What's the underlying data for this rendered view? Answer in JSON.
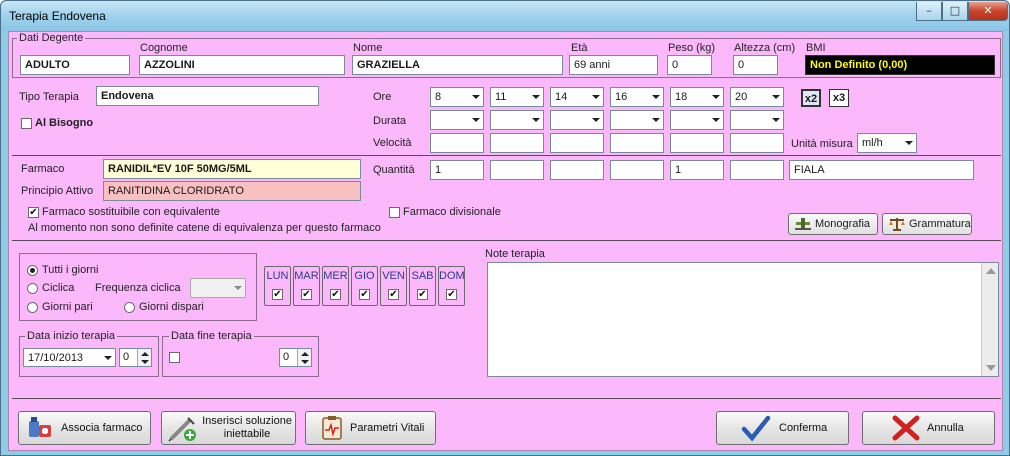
{
  "window": {
    "title": "Terapia Endovena",
    "min_glyph": "–",
    "max_glyph": "□",
    "close_glyph": "✕"
  },
  "patient": {
    "group_label": "Dati Degente",
    "first_label": "ADULTO",
    "surname_label": "Cognome",
    "surname": "AZZOLINI",
    "name_label": "Nome",
    "name": "GRAZIELLA",
    "age_label": "Età",
    "age": "69 anni",
    "weight_label": "Peso (kg)",
    "weight": "0",
    "height_label": "Altezza (cm)",
    "height": "0",
    "bmi_label": "BMI",
    "bmi": "Non Definito (0,00)"
  },
  "therapy": {
    "type_label": "Tipo Terapia",
    "type": "Endovena",
    "as_needed_label": "Al Bisogno",
    "ore_label": "Ore",
    "durata_label": "Durata",
    "velocita_label": "Velocità",
    "hours": [
      "8",
      "11",
      "14",
      "16",
      "18",
      "20"
    ],
    "x2": "x2",
    "x3": "x3",
    "unit_label": "Unità misura",
    "unit": "ml/h"
  },
  "drug": {
    "farmaco_label": "Farmaco",
    "farmaco": "RANIDIL*EV 10F 50MG/5ML",
    "principle_label": "Principio Attivo",
    "principle": "RANITIDINA CLORIDRATO",
    "substitutable_label": "Farmaco sostituibile con equivalente",
    "substitutable_note": "Al momento non sono definite catene di equivalenza per questo farmaco",
    "divisional_label": "Farmaco divisionale",
    "quantity_label": "Quantità",
    "quantities": [
      "1",
      "",
      "",
      "",
      "1",
      ""
    ],
    "quantity_unit": "FIALA",
    "monografia": "Monografia",
    "grammatura": "Grammatura"
  },
  "frequency": {
    "all_days": "Tutti i giorni",
    "cyclic": "Ciclica",
    "cyclic_freq": "Frequenza ciclica",
    "even_days": "Giorni pari",
    "odd_days": "Giorni dispari",
    "days": [
      "LUN",
      "MAR",
      "MER",
      "GIO",
      "VEN",
      "SAB",
      "DOM"
    ]
  },
  "dates": {
    "start_label": "Data inizio terapia",
    "start": "17/10/2013",
    "start_count": "0",
    "end_label": "Data fine terapia",
    "end_count": "0"
  },
  "notes": {
    "label": "Note terapia",
    "text": ""
  },
  "buttons": {
    "associa": "Associa farmaco",
    "inserisci_1": "Inserisci soluzione",
    "inserisci_2": "iniettabile",
    "parametri": "Parametri Vitali",
    "conferma": "Conferma",
    "annulla": "Annulla"
  },
  "colors": {
    "bg": "#fbb9fb",
    "drug_bg": "#ffffd8",
    "principle_bg": "#f8c0c0",
    "bmi_bg": "#000000",
    "bmi_fg": "#ffff00"
  }
}
